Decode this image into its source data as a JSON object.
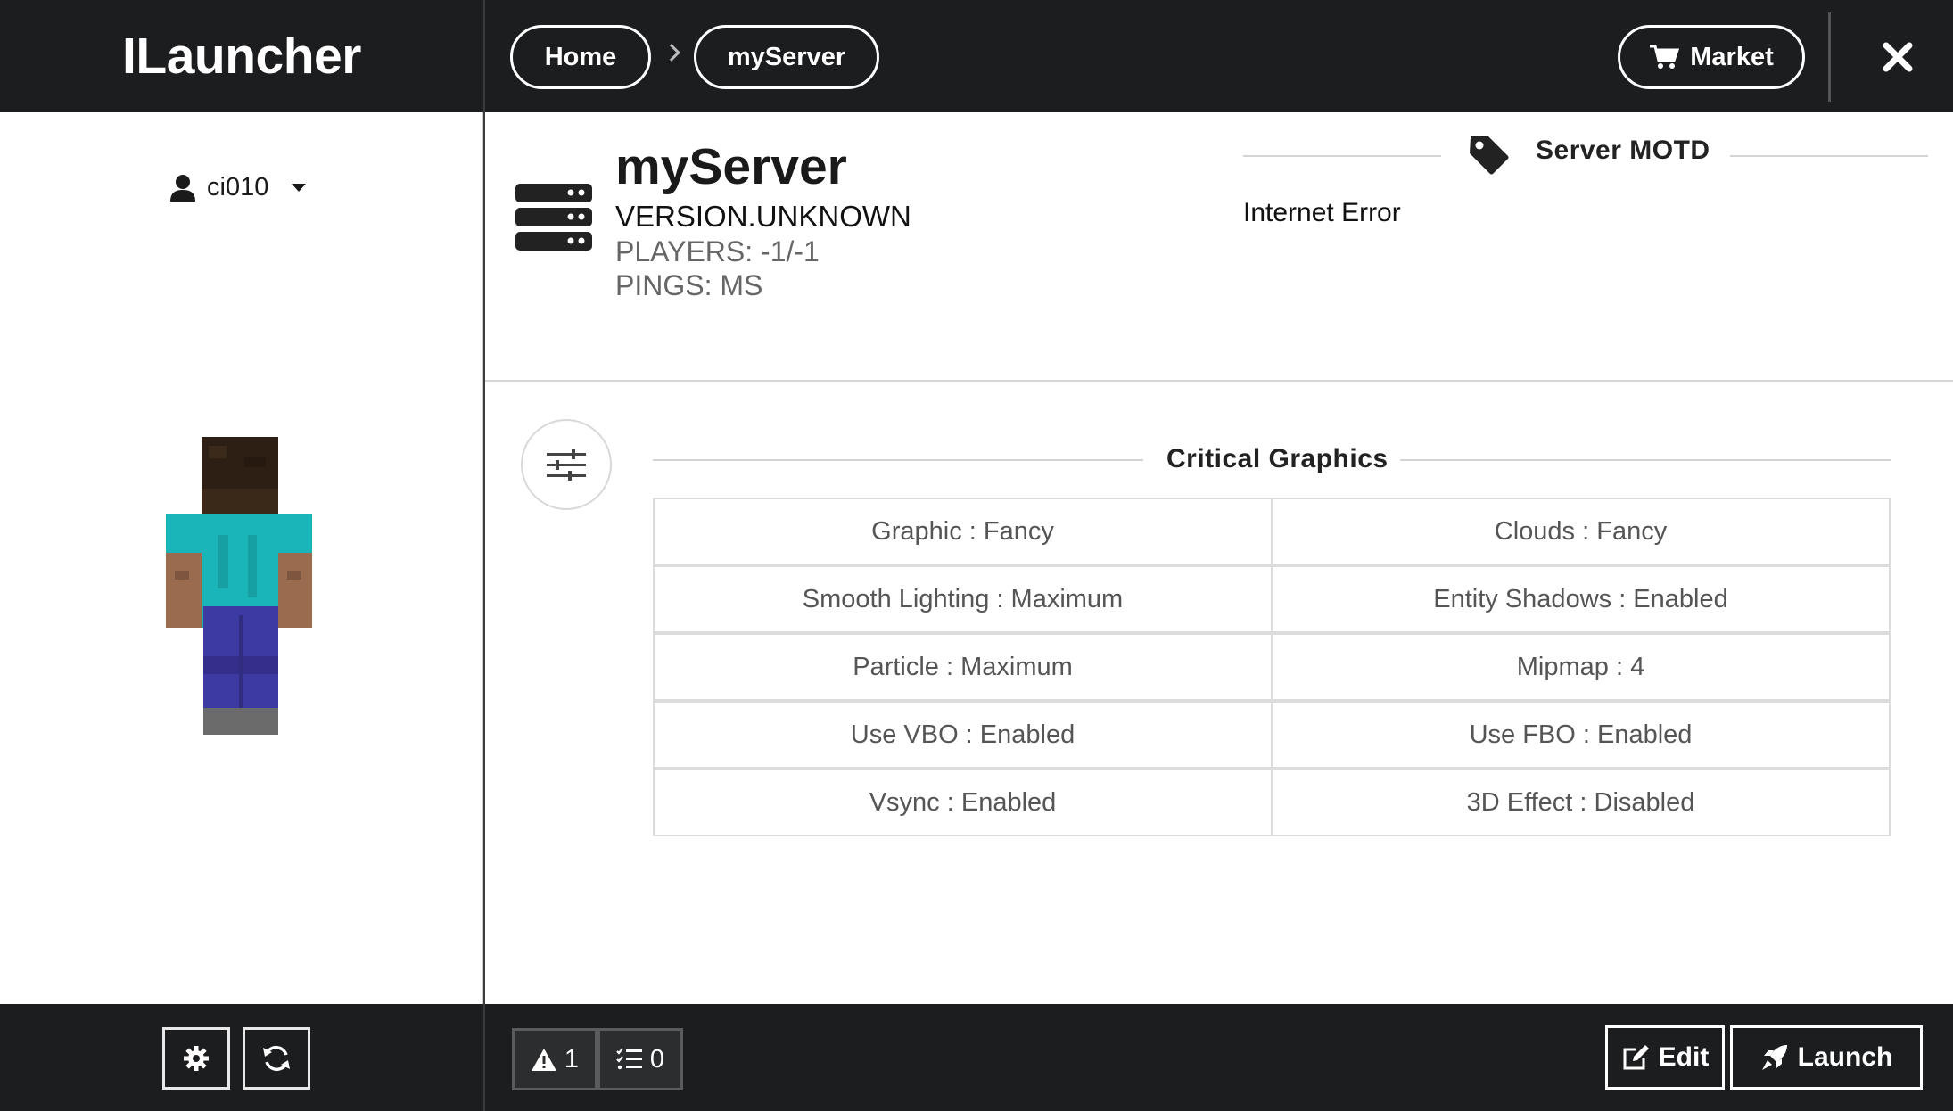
{
  "app": {
    "brand": "ILauncher"
  },
  "user": {
    "name": "ci010",
    "icon": "user-icon"
  },
  "breadcrumb": {
    "home": "Home",
    "current": "myServer"
  },
  "topbar": {
    "market_label": "Market",
    "market_icon": "cart-icon",
    "close_icon": "close-icon"
  },
  "server": {
    "name": "myServer",
    "version": "VERSION.UNKNOWN",
    "players": "PLAYERS: -1/-1",
    "ping": "PINGS: MS"
  },
  "motd": {
    "title": "Server MOTD",
    "text": "Internet Error"
  },
  "graphics": {
    "title": "Critical Graphics",
    "rows": [
      [
        "Graphic : Fancy",
        "Clouds : Fancy"
      ],
      [
        "Smooth Lighting : Maximum",
        "Entity Shadows : Enabled"
      ],
      [
        "Particle : Maximum",
        "Mipmap : 4"
      ],
      [
        "Use VBO : Enabled",
        "Use FBO : Enabled"
      ],
      [
        "Vsync : Enabled",
        "3D Effect : Disabled"
      ]
    ]
  },
  "footer": {
    "warnings": "1",
    "tasks": "0",
    "edit_label": "Edit",
    "launch_label": "Launch"
  },
  "colors": {
    "dark": "#1c1d1f",
    "skin_shirt": "#19b5b9",
    "skin_pants": "#3d3aa3"
  }
}
